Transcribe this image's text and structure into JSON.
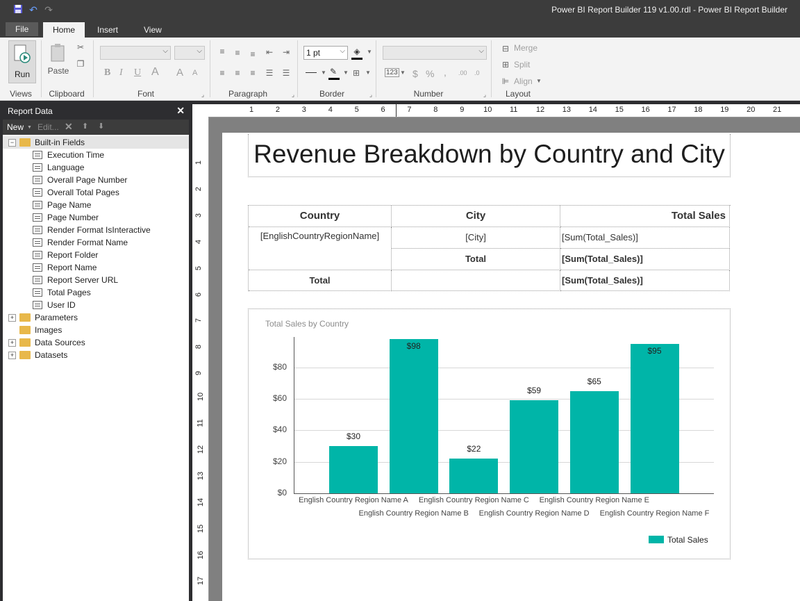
{
  "window": {
    "title": "Power BI Report Builder 119 v1.00.rdl - Power BI Report Builder",
    "quick_access": {
      "save_icon": "save-icon",
      "undo_icon": "undo-icon",
      "redo_icon": "redo-icon"
    }
  },
  "tabs": {
    "file": "File",
    "home": "Home",
    "insert": "Insert",
    "view": "View"
  },
  "ribbon": {
    "views": {
      "run": "Run",
      "label": "Views"
    },
    "clipboard": {
      "paste": "Paste",
      "label": "Clipboard"
    },
    "font": {
      "label": "Font",
      "bold": "B",
      "italic": "I",
      "underline": "U",
      "color": "A",
      "grow": "A",
      "shrink": "A"
    },
    "paragraph": {
      "label": "Paragraph"
    },
    "border": {
      "label": "Border",
      "width": "1 pt"
    },
    "number": {
      "label": "Number",
      "currency": "$",
      "percent": "%",
      "comma": ",",
      "inc": ".00",
      "dec": ".0",
      "placeholder": "123"
    },
    "layout": {
      "label": "Layout",
      "merge": "Merge",
      "split": "Split",
      "align": "Align"
    }
  },
  "report_data": {
    "title": "Report Data",
    "toolbar": {
      "new": "New",
      "edit": "Edit..."
    },
    "built_in": "Built-in Fields",
    "fields": [
      "Execution Time",
      "Language",
      "Overall Page Number",
      "Overall Total Pages",
      "Page Name",
      "Page Number",
      "Render Format IsInteractive",
      "Render Format Name",
      "Report Folder",
      "Report Name",
      "Report Server URL",
      "Total Pages",
      "User ID"
    ],
    "folders": [
      "Parameters",
      "Images",
      "Data Sources",
      "Datasets"
    ]
  },
  "rulers": {
    "h": [
      "1",
      "2",
      "3",
      "4",
      "5",
      "6",
      "7",
      "8",
      "9",
      "10",
      "11",
      "12",
      "13",
      "14",
      "15",
      "16",
      "17",
      "18",
      "19",
      "20",
      "21"
    ],
    "v": [
      "1",
      "2",
      "3",
      "4",
      "5",
      "6",
      "7",
      "8",
      "9",
      "10",
      "11",
      "12",
      "13",
      "14",
      "15",
      "16",
      "17"
    ]
  },
  "report": {
    "title": "Revenue Breakdown by Country and City",
    "table": {
      "headers": [
        "Country",
        "City",
        "Total Sales"
      ],
      "row1": [
        "[EnglishCountryRegionName]",
        "[City]",
        "[Sum(Total_Sales)]"
      ],
      "subtotal": [
        "Total",
        "[Sum(Total_Sales)]"
      ],
      "total": [
        "Total",
        "[Sum(Total_Sales)]"
      ]
    }
  },
  "chart_data": {
    "type": "bar",
    "title": "Total Sales by Country",
    "categories": [
      "English Country Region Name A",
      "English Country Region Name B",
      "English Country Region Name C",
      "English Country Region Name D",
      "English Country Region Name E",
      "English Country Region Name F"
    ],
    "series": [
      {
        "name": "Total Sales",
        "values": [
          30,
          98,
          22,
          59,
          65,
          95
        ]
      }
    ],
    "data_labels": [
      "$30",
      "$98",
      "$22",
      "$59",
      "$65",
      "$95"
    ],
    "yticks": [
      "$0",
      "$20",
      "$40",
      "$60",
      "$80"
    ],
    "ylim": [
      0,
      100
    ],
    "grid": true,
    "legend": "bottom-right",
    "bar_color": "#00b5a8"
  }
}
